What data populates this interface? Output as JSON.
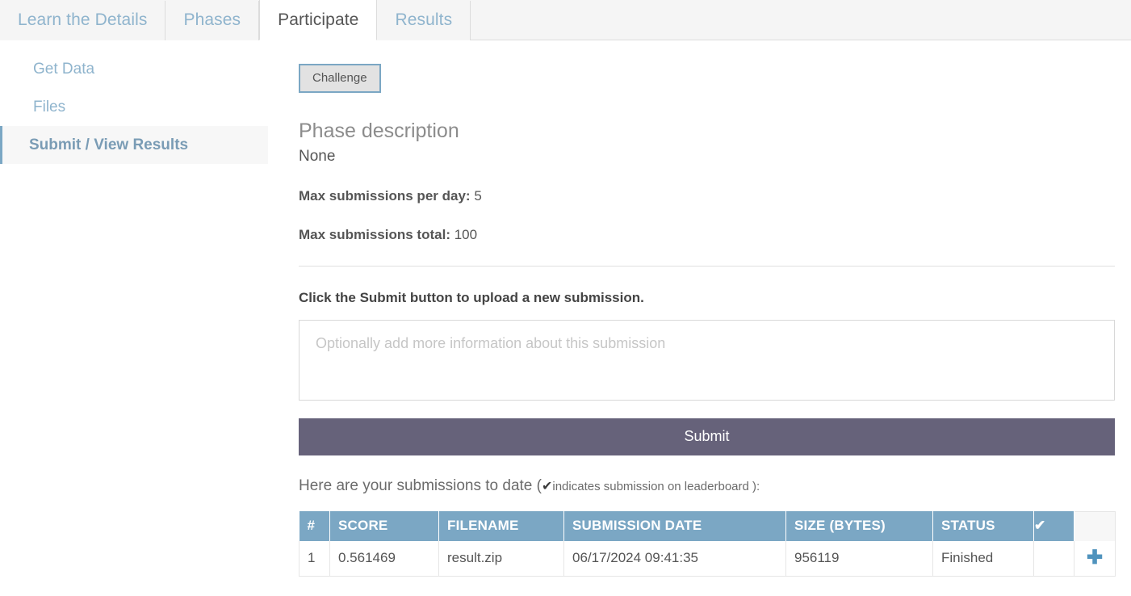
{
  "tabs": [
    {
      "label": "Learn the Details",
      "active": false
    },
    {
      "label": "Phases",
      "active": false
    },
    {
      "label": "Participate",
      "active": true
    },
    {
      "label": "Results",
      "active": false
    }
  ],
  "sidebar": {
    "items": [
      {
        "label": "Get Data",
        "active": false
      },
      {
        "label": "Files",
        "active": false
      },
      {
        "label": "Submit / View Results",
        "active": true
      }
    ]
  },
  "main": {
    "phase_button_label": "Challenge",
    "phase_description_heading": "Phase description",
    "phase_description_value": "None",
    "max_per_day_label": "Max submissions per day:",
    "max_per_day_value": "5",
    "max_total_label": "Max submissions total:",
    "max_total_value": "100",
    "submit_instruction": "Click the Submit button to upload a new submission.",
    "comment_placeholder": "Optionally add more information about this submission",
    "comment_value": "",
    "submit_button_label": "Submit",
    "submissions_lead": "Here are your submissions to date (",
    "submissions_check_glyph": "✔",
    "submissions_note": "indicates submission on leaderboard ):"
  },
  "table": {
    "columns": [
      "#",
      "SCORE",
      "FILENAME",
      "SUBMISSION DATE",
      "SIZE (BYTES)",
      "STATUS",
      "✔",
      ""
    ],
    "rows": [
      {
        "index": "1",
        "score": "0.561469",
        "filename": "result.zip",
        "submission_date": "06/17/2024 09:41:35",
        "size_bytes": "956119",
        "status": "Finished",
        "on_leaderboard": "",
        "expand_icon": "✚"
      }
    ]
  },
  "colors": {
    "tab_active_text": "#555555",
    "tab_inactive_text": "#8fb4cd",
    "tabbar_bg": "#f5f5f5",
    "sidebar_link": "#8fb4cd",
    "sidebar_active_border": "#7ba7c4",
    "table_header_bg": "#7ba7c4",
    "submit_button_bg": "#66627a",
    "challenge_button_border": "#7ba7c4",
    "plus_icon": "#4f93bd"
  }
}
